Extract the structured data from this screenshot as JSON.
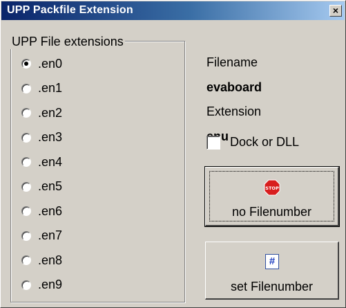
{
  "window": {
    "title": "UPP Packfile Extension",
    "close_glyph": "×"
  },
  "group": {
    "legend": "UPP File extensions",
    "selected_index": 0,
    "options": [
      {
        "label": ".en0",
        "checked": true
      },
      {
        "label": ".en1",
        "checked": false
      },
      {
        "label": ".en2",
        "checked": false
      },
      {
        "label": ".en3",
        "checked": false
      },
      {
        "label": ".en4",
        "checked": false
      },
      {
        "label": ".en5",
        "checked": false
      },
      {
        "label": ".en6",
        "checked": false
      },
      {
        "label": ".en7",
        "checked": false
      },
      {
        "label": ".en8",
        "checked": false
      },
      {
        "label": ".en9",
        "checked": false
      }
    ]
  },
  "info": {
    "filename_label": "Filename",
    "filename_value": "evaboard",
    "extension_label": "Extension",
    "extension_value": "enu"
  },
  "options": {
    "dock_label": "Dock or DLL",
    "dock_checked": false
  },
  "buttons": {
    "no_filenumber": {
      "label": "no Filenumber",
      "icon": "stop-sign-icon",
      "icon_text": "STOP"
    },
    "set_filenumber": {
      "label": "set Filenumber",
      "icon": "hash-document-icon",
      "icon_text": "#"
    }
  },
  "colors": {
    "titlebar_start": "#0a246a",
    "titlebar_end": "#a6caf0",
    "face": "#d4d0c8",
    "stop_red": "#d81e1e"
  }
}
